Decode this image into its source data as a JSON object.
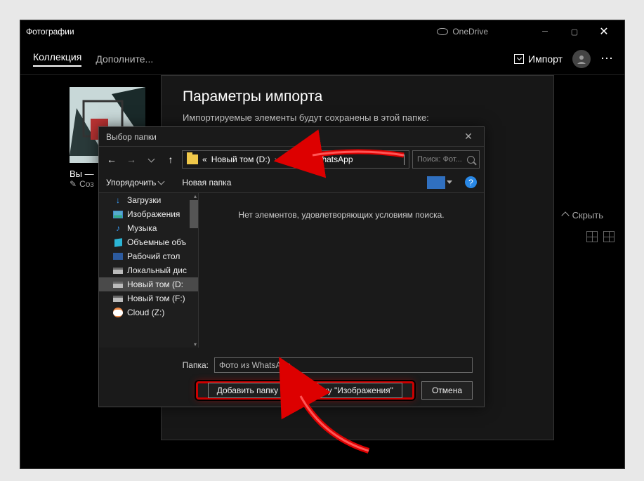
{
  "app": {
    "title": "Фотографии",
    "onedrive": "OneDrive"
  },
  "tabs": {
    "collection": "Коллекция",
    "more": "Дополните...",
    "import": "Импорт"
  },
  "hide": "Скрыть",
  "thumb": {
    "caption": "Вы —",
    "sub": "Соз"
  },
  "import_panel": {
    "title": "Параметры импорта",
    "subtitle": "Импортируемые элементы будут сохранены в этой папке:"
  },
  "picker": {
    "title": "Выбор папки",
    "breadcrumb": {
      "prefix": "«",
      "drive": "Новый том (D:)",
      "folder": "Фото из WhatsApp"
    },
    "search_placeholder": "Поиск: Фот...",
    "toolbar": {
      "organize": "Упорядочить",
      "new_folder": "Новая папка"
    },
    "tree": [
      {
        "icon": "dl",
        "label": "Загрузки"
      },
      {
        "icon": "img",
        "label": "Изображения"
      },
      {
        "icon": "music",
        "label": "Музыка"
      },
      {
        "icon": "cube",
        "label": "Объемные объ"
      },
      {
        "icon": "desk",
        "label": "Рабочий стол"
      },
      {
        "icon": "drive",
        "label": "Локальный дис"
      },
      {
        "icon": "drive",
        "label": "Новый том (D:",
        "selected": true
      },
      {
        "icon": "drive",
        "label": "Новый том (F:)"
      },
      {
        "icon": "cloud",
        "label": "Cloud (Z:)"
      }
    ],
    "empty_message": "Нет элементов, удовлетворяющих условиям поиска.",
    "footer": {
      "label": "Папка:",
      "value": "Фото из WhatsApp",
      "add_button": "Добавить папку в библиотеку \"Изображения\"",
      "cancel": "Отмена"
    }
  }
}
